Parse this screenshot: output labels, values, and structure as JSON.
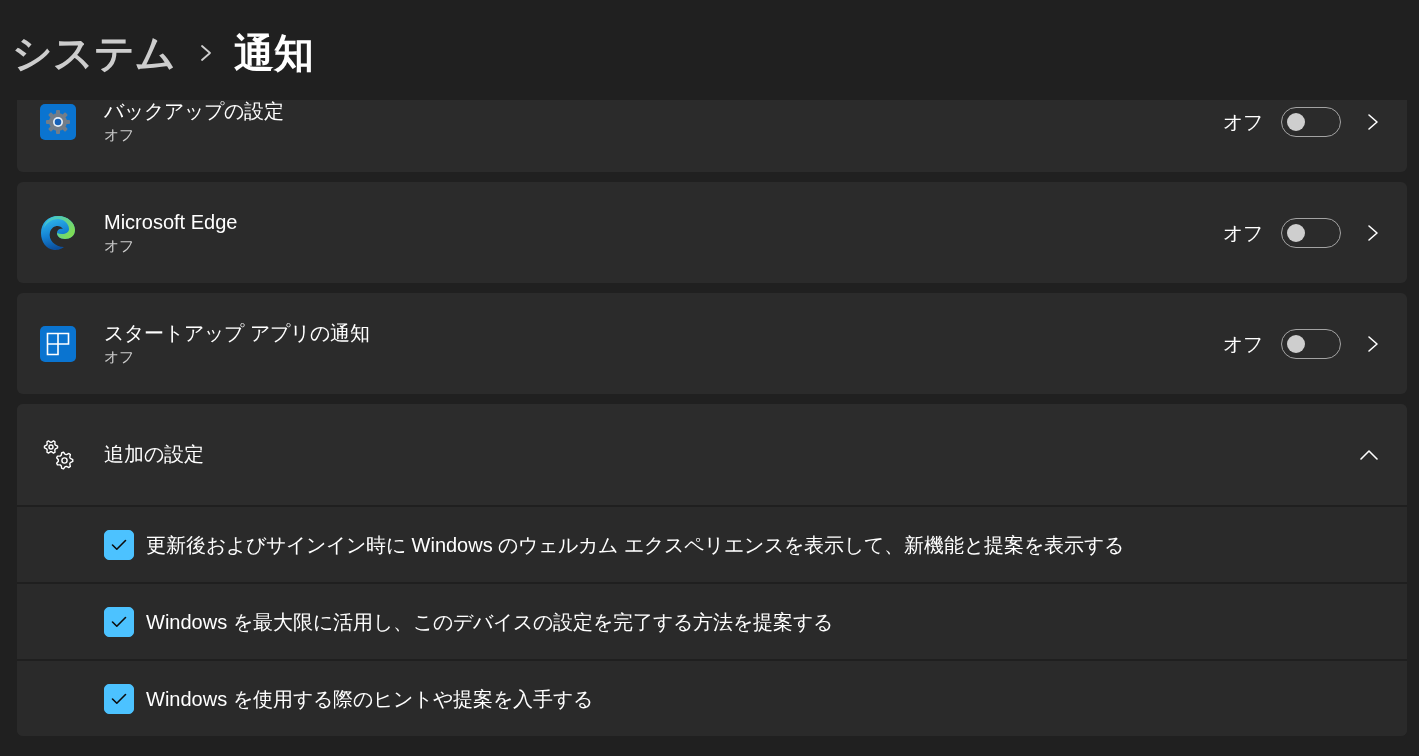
{
  "breadcrumb": {
    "parent": "システム",
    "current": "通知"
  },
  "apps": [
    {
      "name": "バックアップの設定",
      "status": "オフ",
      "toggle_label": "オフ",
      "on": false
    },
    {
      "name": "Microsoft Edge",
      "status": "オフ",
      "toggle_label": "オフ",
      "on": false
    },
    {
      "name": "スタートアップ アプリの通知",
      "status": "オフ",
      "toggle_label": "オフ",
      "on": false
    }
  ],
  "additional_settings": {
    "label": "追加の設定",
    "expanded": true,
    "options": [
      {
        "label": "更新後およびサインイン時に Windows のウェルカム エクスペリエンスを表示して、新機能と提案を表示する",
        "checked": true
      },
      {
        "label": "Windows を最大限に活用し、このデバイスの設定を完了する方法を提案する",
        "checked": true
      },
      {
        "label": "Windows を使用する際のヒントや提案を入手する",
        "checked": true
      }
    ]
  }
}
